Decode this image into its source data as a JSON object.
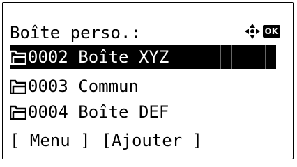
{
  "screen": {
    "title": "Boîte perso.:",
    "ok_label": "OK"
  },
  "list": {
    "items": [
      {
        "text": "0002 Boîte XYZ",
        "icon": "folder-icon",
        "selected": true
      },
      {
        "text": "0003 Commun",
        "icon": "folder-icon",
        "selected": false
      },
      {
        "text": "0004 Boîte DEF",
        "icon": "folder-icon",
        "selected": false
      }
    ]
  },
  "softkeys": {
    "left": "[ Menu ]",
    "right": "[Ajouter ]"
  },
  "colors": {
    "foreground": "#000000",
    "background": "#ffffff",
    "selection": "#000000",
    "selection_text": "#ffffff"
  }
}
